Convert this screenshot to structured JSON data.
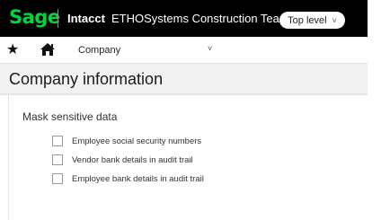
{
  "header": {
    "logo": "Sage",
    "product": "Intacct",
    "company_name": "ETHOSystems Construction Team",
    "level_button": "Top level",
    "level_chevron": "˅"
  },
  "nav": {
    "star": "★",
    "company_menu": "Company",
    "company_chevron": "˅"
  },
  "page": {
    "title": "Company information"
  },
  "section": {
    "title": "Mask sensitive data",
    "options": [
      {
        "label": "Employee social security numbers",
        "checked": false
      },
      {
        "label": "Vendor bank details in audit trail",
        "checked": false
      },
      {
        "label": "Employee bank details in audit trail",
        "checked": false
      }
    ]
  },
  "colors": {
    "logo_green": "#00d639",
    "topbar_bg": "#000000"
  }
}
